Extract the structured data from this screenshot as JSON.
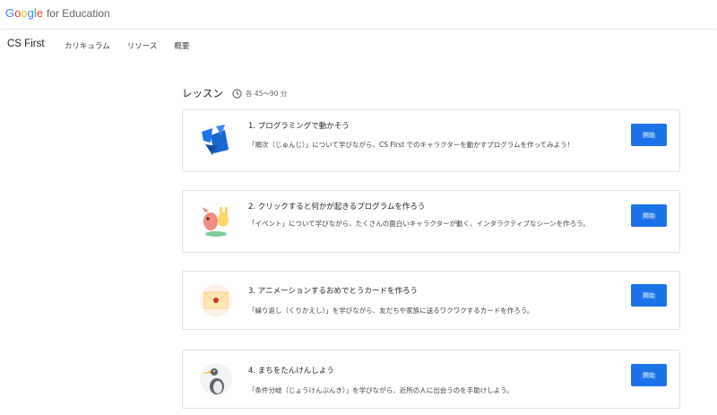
{
  "header": {
    "logo_letters": [
      "G",
      "o",
      "o",
      "g",
      "l",
      "e"
    ],
    "logo_suffix": "for Education"
  },
  "nav": {
    "brand": "CS First",
    "links": [
      "カリキュラム",
      "リソース",
      "概要"
    ]
  },
  "lessons_section": {
    "title": "レッスン",
    "duration": "各 45〜90 分",
    "icon": "clock-icon"
  },
  "lessons": [
    {
      "title": "1. プログラミングで動かそう",
      "description": "「順次（じゅんじ）」について学びながら、CS First でのキャラクターを動かすプログラムを作ってみよう！",
      "button": "開始",
      "icon": "blue-shapes-icon"
    },
    {
      "title": "2. クリックすると何かが起きるプログラムを作ろう",
      "description": "「イベント」について学びながら、たくさんの面白いキャラクターが動く、インタラクティブなシーンを作ろう。",
      "button": "開始",
      "icon": "characters-icon"
    },
    {
      "title": "3. アニメーションするおめでとうカードを作ろう",
      "description": "「繰り返し（くりかえし）」を学びながら、友だちや家族に送るワクワクするカードを作ろう。",
      "button": "開始",
      "icon": "envelope-icon"
    },
    {
      "title": "4. まちをたんけんしよう",
      "description": "「条件分岐（じょうけんぶんき）」を学びながら、近所の人に出会うのを手助けしよう。",
      "button": "開始",
      "icon": "bird-icon"
    }
  ],
  "colors": {
    "primary_button": "#1a73e8",
    "border": "#e0e0e0"
  }
}
